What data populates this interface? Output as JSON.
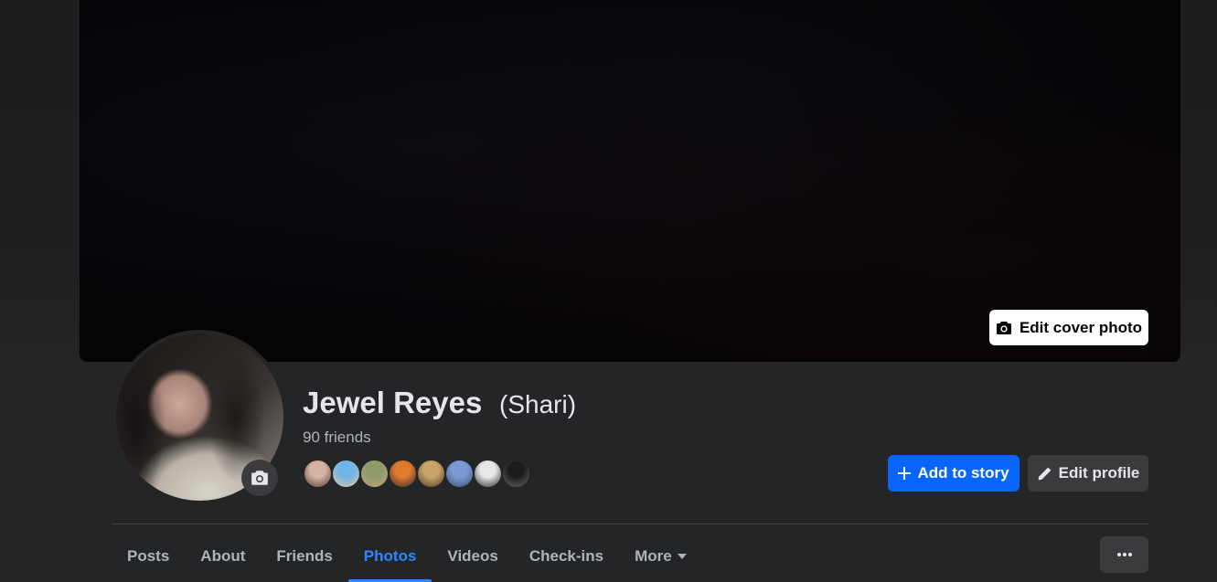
{
  "cover": {
    "edit_cover_label": "Edit cover photo",
    "icon": "camera-icon"
  },
  "profile": {
    "name": "Jewel Reyes",
    "alternate_name": "(Shari)",
    "friends_count_label": "90 friends",
    "avatar_camera_icon": "camera-icon"
  },
  "friend_avatars": [
    {
      "colors": [
        "#d6b3a4",
        "#5a3b32"
      ]
    },
    {
      "colors": [
        "#6fb6e8",
        "#e8c49a"
      ]
    },
    {
      "colors": [
        "#8f9a6b",
        "#c8a27c"
      ]
    },
    {
      "colors": [
        "#e07a2e",
        "#2c2a2a"
      ]
    },
    {
      "colors": [
        "#c9a46a",
        "#4a3a28"
      ]
    },
    {
      "colors": [
        "#7c9ad1",
        "#3c4f73"
      ]
    },
    {
      "colors": [
        "#e8e8e8",
        "#2a2a2a"
      ]
    },
    {
      "colors": [
        "#1c1c1c",
        "#6a6a6a"
      ]
    }
  ],
  "actions": {
    "add_to_story": "Add to story",
    "edit_profile": "Edit profile"
  },
  "tabs": [
    {
      "label": "Posts",
      "active": false
    },
    {
      "label": "About",
      "active": false
    },
    {
      "label": "Friends",
      "active": false
    },
    {
      "label": "Photos",
      "active": true
    },
    {
      "label": "Videos",
      "active": false
    },
    {
      "label": "Check-ins",
      "active": false
    },
    {
      "label": "More",
      "active": false,
      "dropdown": true
    }
  ],
  "colors": {
    "accent": "#0866ff",
    "active_tab": "#2d88ff",
    "surface": "#242526",
    "button_secondary": "#3a3b3c",
    "text_primary": "#e4e6eb",
    "text_secondary": "#b0b3b8"
  }
}
